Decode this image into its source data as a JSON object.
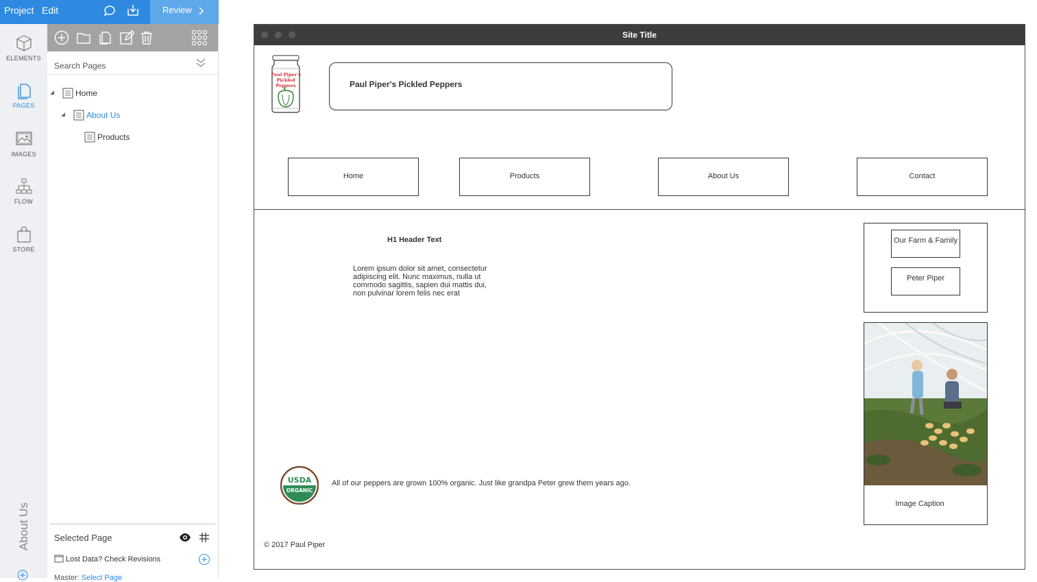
{
  "topbar": {
    "menu": [
      "Project",
      "Edit"
    ],
    "review_label": "Review"
  },
  "rail": {
    "items": [
      {
        "label": "ELEMENTS",
        "icon": "cube-icon"
      },
      {
        "label": "PAGES",
        "icon": "pages-icon"
      },
      {
        "label": "IMAGES",
        "icon": "image-icon"
      },
      {
        "label": "FLOW",
        "icon": "flow-icon"
      },
      {
        "label": "STORE",
        "icon": "bag-icon"
      }
    ],
    "active": "PAGES",
    "vertical_label": "About Us"
  },
  "pages_panel": {
    "search_placeholder": "Search Pages",
    "tree": [
      {
        "label": "Home",
        "level": 0
      },
      {
        "label": "About Us",
        "level": 1
      },
      {
        "label": "Products",
        "level": 2
      }
    ],
    "selected_page_label": "Selected Page",
    "lost_data_label": "Lost Data? Check Revisions",
    "master_prefix": "Master:",
    "master_value": "Select Page"
  },
  "site": {
    "window_title": "Site Title",
    "brand": "Paul Piper's Pickled Peppers",
    "jar_label": [
      "Paul Piper's",
      "Pickled",
      "Peppers"
    ],
    "nav": [
      "Home",
      "Products",
      "About Us",
      "Contact"
    ],
    "h1": "H1 Header Text",
    "lorem": "Lorem ipsum dolor sit amet, consectetur adipiscing elit. Nunc maximus, nulla ut commodo sagittis, sapien dui mattis dui, non pulvinar lorem felis nec erat",
    "sidebar_links": [
      "Our Farm & Family",
      "Peter Piper"
    ],
    "image_caption": "Image Caption",
    "usda_top": "USDA",
    "usda_bottom": "ORGANIC",
    "organic_text": "All of our peppers are grown 100% organic. Just like grandpa Peter grew them years ago.",
    "copyright": "© 2017 Paul Piper"
  },
  "colors": {
    "accent": "#2d8ae0",
    "titlebar": "#3d3d3d",
    "toolbar": "#a3a3a3",
    "rail_bg": "#eef0f3",
    "usda_green": "#2e8b57",
    "usda_brown": "#7a4a2a"
  }
}
